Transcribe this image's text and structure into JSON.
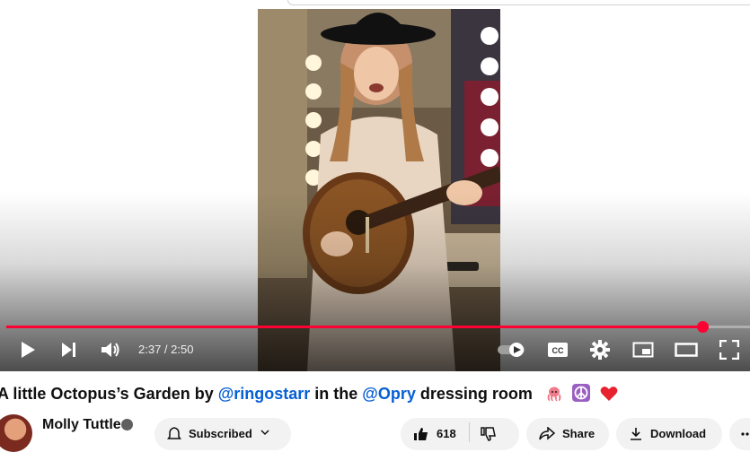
{
  "video": {
    "current_time": "2:37",
    "duration": "2:50",
    "time_display": "2:37 / 2:50",
    "progress_fraction": 0.936
  },
  "title": {
    "prefix": "A little Octopus’s Garden by ",
    "mention1": "@ringostarr",
    "middle": " in the ",
    "mention2": "@Opry",
    "suffix": " dressing room",
    "emojis": [
      "octopus-emoji",
      "peace-symbol-emoji",
      "red-heart-emoji"
    ]
  },
  "channel": {
    "name": "Molly Tuttle",
    "subscribe_label": "Subscribed"
  },
  "actions": {
    "like_count": "618",
    "share_label": "Share",
    "download_label": "Download"
  },
  "colors": {
    "progress": "#ff0033",
    "mention": "#065fd4"
  }
}
